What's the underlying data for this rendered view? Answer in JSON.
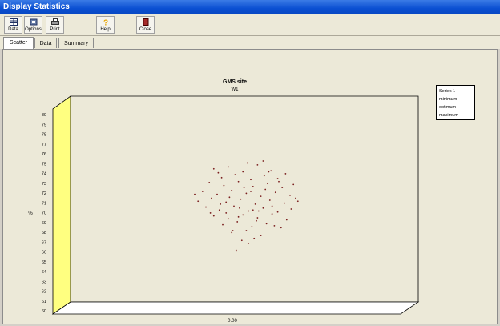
{
  "window": {
    "title": "Display Statistics"
  },
  "toolbar": {
    "buttons": [
      {
        "label": "Data",
        "icon": "grid-icon"
      },
      {
        "label": "Options",
        "icon": "options-icon"
      },
      {
        "label": "Print",
        "icon": "printer-icon"
      },
      {
        "label": "Help",
        "icon": "help-icon"
      },
      {
        "label": "Close",
        "icon": "door-icon"
      }
    ]
  },
  "tabs": [
    {
      "label": "Scatter",
      "active": true
    },
    {
      "label": "Data",
      "active": false
    },
    {
      "label": "Summary",
      "active": false
    }
  ],
  "legend": {
    "items": [
      "Series 1",
      "minimum",
      "optimum",
      "maximum"
    ]
  },
  "chart_data": {
    "type": "scatter",
    "title": "GMS site",
    "subtitle": "W1",
    "xlabel": "0.00",
    "ylabel": "%",
    "ylim": [
      60,
      80
    ],
    "yticks": [
      "80",
      "79",
      "78",
      "77",
      "76",
      "75",
      "74",
      "73",
      "72",
      "71",
      "70",
      "69",
      "68",
      "67",
      "66",
      "65",
      "64",
      "63",
      "62",
      "61",
      "60"
    ],
    "grid": false,
    "legend_position": "right",
    "colors": {
      "points": "#7a1e1e",
      "wall": "#ffff80",
      "floor": "#ffffff"
    },
    "points": [
      [
        0.22,
        75.2
      ],
      [
        0.35,
        75.4
      ],
      [
        0.48,
        74.9
      ],
      [
        0.61,
        75.6
      ],
      [
        0.73,
        75.0
      ],
      [
        0.86,
        74.7
      ],
      [
        0.29,
        74.3
      ],
      [
        0.41,
        74.6
      ],
      [
        0.55,
        74.1
      ],
      [
        0.67,
        74.5
      ],
      [
        0.79,
        74.2
      ],
      [
        0.18,
        73.8
      ],
      [
        0.31,
        73.5
      ],
      [
        0.44,
        73.9
      ],
      [
        0.57,
        73.4
      ],
      [
        0.7,
        73.7
      ],
      [
        0.83,
        73.3
      ],
      [
        0.93,
        73.6
      ],
      [
        0.12,
        72.9
      ],
      [
        0.25,
        72.6
      ],
      [
        0.38,
        73.0
      ],
      [
        0.51,
        72.7
      ],
      [
        0.64,
        72.4
      ],
      [
        0.77,
        72.8
      ],
      [
        0.9,
        72.5
      ],
      [
        0.08,
        71.9
      ],
      [
        0.2,
        72.2
      ],
      [
        0.33,
        71.8
      ],
      [
        0.46,
        72.1
      ],
      [
        0.59,
        71.6
      ],
      [
        0.72,
        72.0
      ],
      [
        0.85,
        71.7
      ],
      [
        0.97,
        71.9
      ],
      [
        0.15,
        71.3
      ],
      [
        0.27,
        71.0
      ],
      [
        0.4,
        71.4
      ],
      [
        0.53,
        70.9
      ],
      [
        0.66,
        71.2
      ],
      [
        0.79,
        70.8
      ],
      [
        0.91,
        71.1
      ],
      [
        0.22,
        70.4
      ],
      [
        0.35,
        70.1
      ],
      [
        0.48,
        70.5
      ],
      [
        0.61,
        70.2
      ],
      [
        0.74,
        70.6
      ],
      [
        0.87,
        70.0
      ],
      [
        0.3,
        69.5
      ],
      [
        0.43,
        69.8
      ],
      [
        0.56,
        69.3
      ],
      [
        0.69,
        69.6
      ],
      [
        0.82,
        69.2
      ],
      [
        0.38,
        68.7
      ],
      [
        0.51,
        68.9
      ],
      [
        0.64,
        68.4
      ],
      [
        0.47,
        67.9
      ],
      [
        0.58,
        68.1
      ],
      [
        0.42,
        66.9
      ],
      [
        0.26,
        74.8
      ],
      [
        0.68,
        73.1
      ],
      [
        0.52,
        75.8
      ],
      [
        0.36,
        72.3
      ],
      [
        0.74,
        71.4
      ],
      [
        0.19,
        70.7
      ],
      [
        0.6,
        69.9
      ],
      [
        0.45,
        71.2
      ],
      [
        0.55,
        72.9
      ],
      [
        0.33,
        70.7
      ],
      [
        0.8,
        73.9
      ],
      [
        0.62,
        70.9
      ],
      [
        0.49,
        73.3
      ],
      [
        0.28,
        71.6
      ],
      [
        0.71,
        74.9
      ],
      [
        0.39,
        68.9
      ],
      [
        0.53,
        67.6
      ],
      [
        0.95,
        72.2
      ],
      [
        0.05,
        72.6
      ],
      [
        0.66,
        76.0
      ],
      [
        0.57,
        71.0
      ],
      [
        0.44,
        70.3
      ],
      [
        0.76,
        69.4
      ]
    ]
  }
}
